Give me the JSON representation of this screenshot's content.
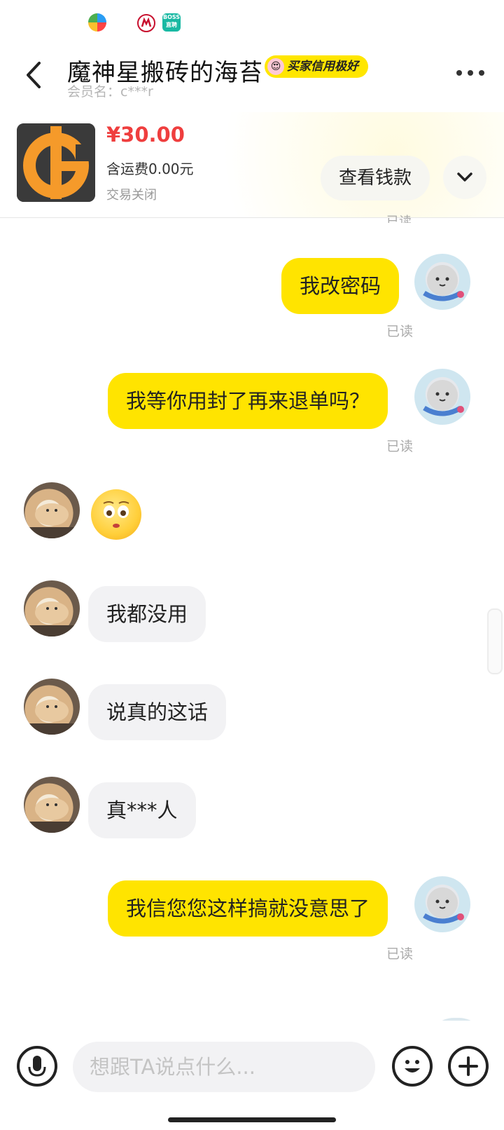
{
  "status_bar": {
    "icons": [
      "app-icon-1",
      "china-merchants-bank-icon",
      "boss-zhipin-icon"
    ],
    "boss_label_top": "BOSS",
    "boss_label_bottom": "直聘"
  },
  "header": {
    "title": "魔神星搬砖的海苔",
    "badge": "买家信用极好",
    "member": "会员名：c***r"
  },
  "product": {
    "price": "¥30.00",
    "shipping": "含运费0.00元",
    "status": "交易关闭",
    "view_button": "查看钱款"
  },
  "read_label": "已读",
  "messages": [
    {
      "from": "me",
      "text": "我改密码",
      "read": "已读"
    },
    {
      "from": "me",
      "text": "我等你用封了再来退单吗？",
      "read": "已读"
    },
    {
      "from": "them",
      "type": "emoji",
      "icon": "flushed-face-emoji"
    },
    {
      "from": "them",
      "text": "我都没用"
    },
    {
      "from": "them",
      "text": "说真的这话"
    },
    {
      "from": "them",
      "text": "真***人"
    },
    {
      "from": "me",
      "text": "我信您您这样搞就没意思了",
      "read": "已读"
    }
  ],
  "input": {
    "placeholder": "想跟TA说点什么..."
  },
  "colors": {
    "accent": "#ffe400",
    "price": "#ef3e3e",
    "their_bubble": "#f2f2f4"
  }
}
